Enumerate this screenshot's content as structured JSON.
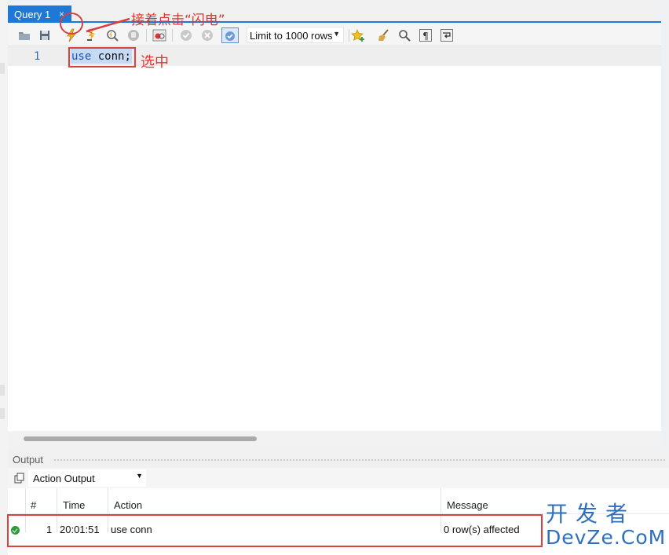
{
  "editor_tab": {
    "title": "Query 1",
    "close_glyph": "×"
  },
  "toolbar": {
    "icons": [
      "open-folder-icon",
      "save-icon",
      "execute-lightning-icon",
      "execute-current-icon",
      "explain-magnifier-icon",
      "stop-icon",
      "toggle-continue-on-error-icon",
      "commit-icon",
      "rollback-icon",
      "autocommit-toggle-icon",
      "add-snippet-star-icon",
      "beautify-broom-icon",
      "find-icon",
      "invisible-chars-pilcrow-icon",
      "wrap-lines-icon"
    ],
    "limit_label": "Limit to 1000 rows"
  },
  "editor": {
    "line_number": "1",
    "code_keyword": "use",
    "code_rest": " conn;"
  },
  "annotations": {
    "click_hint": "接着点击“闪电”",
    "select_hint": "选中",
    "color": "#e0342f"
  },
  "output": {
    "panel_title": "Output",
    "selector_value": "Action Output",
    "columns": [
      "#",
      "Time",
      "Action",
      "Message"
    ],
    "rows": [
      {
        "status": "success",
        "index": "1",
        "time": "20:01:51",
        "action": "use conn",
        "message": "0 row(s) affected"
      }
    ]
  },
  "watermark": {
    "cn": "开发者",
    "en": "DevZe.CoM"
  },
  "colors": {
    "accent": "#1e79d6",
    "success": "#2e9a3a",
    "highlight": "#c5dbf3"
  }
}
